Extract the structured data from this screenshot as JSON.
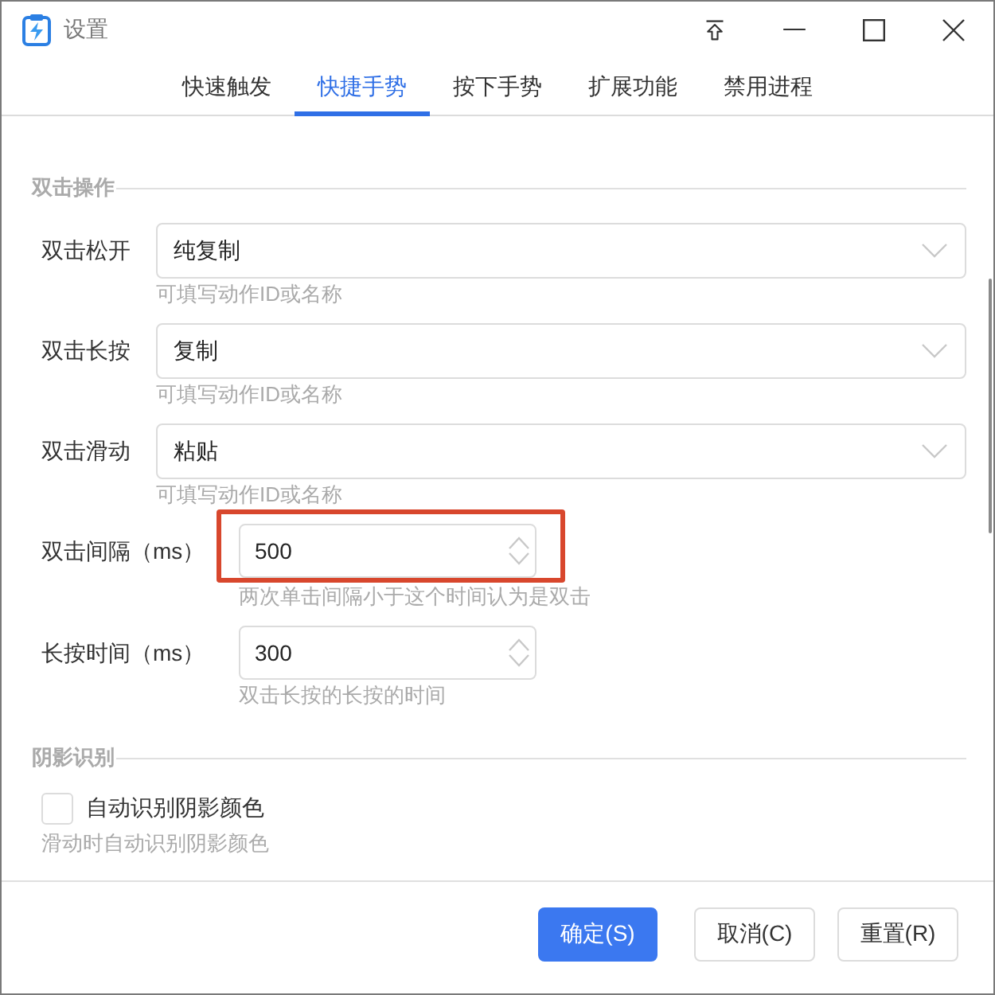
{
  "window": {
    "title": "设置"
  },
  "tabs": [
    {
      "label": "快速触发",
      "selected": false
    },
    {
      "label": "快捷手势",
      "selected": true
    },
    {
      "label": "按下手势",
      "selected": false
    },
    {
      "label": "扩展功能",
      "selected": false
    },
    {
      "label": "禁用进程",
      "selected": false
    }
  ],
  "content": {
    "sections": [
      {
        "title": "双击操作",
        "fields": [
          {
            "kind": "select",
            "label": "双击松开",
            "value": "纯复制",
            "hint": "可填写动作ID或名称",
            "highlighted": false
          },
          {
            "kind": "select",
            "label": "双击长按",
            "value": "复制",
            "hint": "可填写动作ID或名称",
            "highlighted": false
          },
          {
            "kind": "select",
            "label": "双击滑动",
            "value": "粘贴",
            "hint": "可填写动作ID或名称",
            "highlighted": false
          },
          {
            "kind": "number",
            "label": "双击间隔（ms）",
            "value": "500",
            "hint": "两次单击间隔小于这个时间认为是双击",
            "highlighted": true
          },
          {
            "kind": "number",
            "label": "长按时间（ms）",
            "value": "300",
            "hint": "双击长按的长按的时间",
            "highlighted": false
          }
        ]
      },
      {
        "title": "阴影识别",
        "fields": [
          {
            "kind": "checkbox",
            "label": "自动识别阴影颜色",
            "checked": false,
            "hint": "滑动时自动识别阴影颜色",
            "highlighted": false
          }
        ]
      }
    ]
  },
  "buttons": [
    {
      "label": "确定(S)",
      "primary": true
    },
    {
      "label": "取消(C)",
      "primary": false
    },
    {
      "label": "重置(R)",
      "primary": false
    }
  ]
}
